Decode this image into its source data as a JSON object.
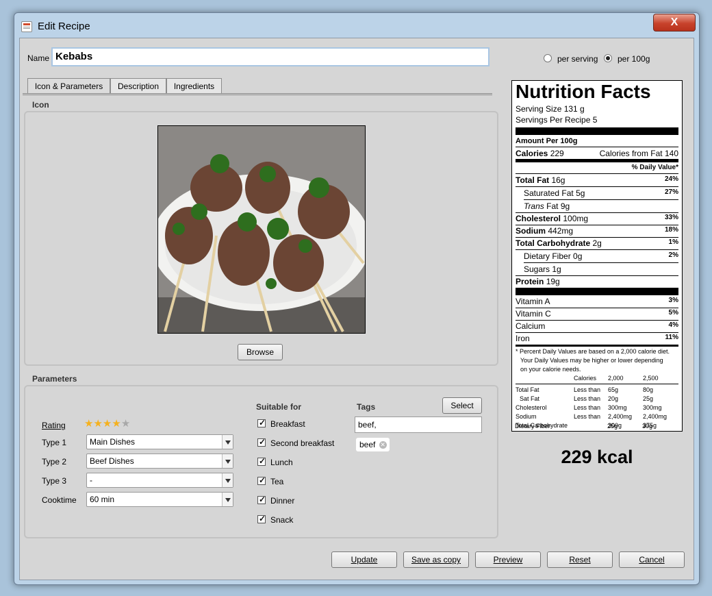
{
  "window": {
    "title": "Edit Recipe",
    "close_label": "X"
  },
  "name": {
    "label": "Name",
    "value": "Kebabs"
  },
  "units": {
    "per_serving": "per serving",
    "per_100g": "per 100g",
    "selected": "per_100g"
  },
  "tabs": [
    "Icon & Parameters",
    "Description",
    "Ingredients"
  ],
  "icon_section": {
    "title": "Icon",
    "image": "kebab-photo",
    "browse_label": "Browse"
  },
  "parameters": {
    "title": "Parameters",
    "rating_label": "Rating",
    "rating": 4,
    "rating_max": 5,
    "type1_label": "Type 1",
    "type1_value": "Main Dishes",
    "type2_label": "Type 2",
    "type2_value": "Beef Dishes",
    "type3_label": "Type 3",
    "type3_value": "-",
    "cooktime_label": "Cooktime",
    "cooktime_value": "60 min"
  },
  "suitable": {
    "title": "Suitable for",
    "items": [
      {
        "label": "Breakfast",
        "checked": true
      },
      {
        "label": "Second breakfast",
        "checked": true
      },
      {
        "label": "Lunch",
        "checked": true
      },
      {
        "label": "Tea",
        "checked": true
      },
      {
        "label": "Dinner",
        "checked": true
      },
      {
        "label": "Snack",
        "checked": true
      }
    ]
  },
  "tags": {
    "title": "Tags",
    "select_label": "Select",
    "input_value": "beef,",
    "chips": [
      "beef"
    ]
  },
  "nutrition": {
    "heading": "Nutrition Facts",
    "serving_size": "Serving Size 131 g",
    "servings_per_recipe": "Servings Per Recipe 5",
    "amount_per": "Amount Per 100g",
    "calories_label": "Calories",
    "calories": "229",
    "calories_fat": "Calories from Fat 140",
    "dv_header": "% Daily Value*",
    "rows": {
      "total_fat": {
        "label": "Total Fat",
        "amount": "16g",
        "dv": "24%"
      },
      "sat_fat": {
        "label": "Saturated Fat",
        "amount": "5g",
        "dv": "27%"
      },
      "trans_fat": {
        "label": "Trans",
        "label2": "Fat",
        "amount": "9g"
      },
      "cholesterol": {
        "label": "Cholesterol",
        "amount": "100mg",
        "dv": "33%"
      },
      "sodium": {
        "label": "Sodium",
        "amount": "442mg",
        "dv": "18%"
      },
      "carb": {
        "label": "Total Carbohydrate",
        "amount": "2g",
        "dv": "1%"
      },
      "fiber": {
        "label": "Dietary Fiber",
        "amount": "0g",
        "dv": "2%"
      },
      "sugars": {
        "label": "Sugars",
        "amount": "1g"
      },
      "protein": {
        "label": "Protein",
        "amount": "19g"
      }
    },
    "vitamins": [
      {
        "label": "Vitamin A",
        "dv": "3%"
      },
      {
        "label": "Vitamin C",
        "dv": "5%"
      },
      {
        "label": "Calcium",
        "dv": "4%"
      },
      {
        "label": "Iron",
        "dv": "11%"
      }
    ],
    "footnote1": "* Percent Daily Values are based on a 2,000 calorie diet.",
    "footnote2": "Your Daily Values may be higher or lower depending",
    "footnote3": "on your calorie needs.",
    "table_header": [
      "Calories",
      "2,000",
      "2,500"
    ],
    "table_rows": [
      [
        "Total Fat",
        "Less than",
        "65g",
        "80g"
      ],
      [
        "Sat Fat",
        "Less than",
        "20g",
        "25g"
      ],
      [
        "Cholesterol",
        "Less than",
        "300mg",
        "300mg"
      ],
      [
        "Sodium",
        "Less than",
        "2,400mg",
        "2,400mg"
      ],
      [
        "Total Carbohydrate",
        "",
        "300g",
        "375g"
      ],
      [
        "Dietary Fiber",
        "",
        "25g",
        "30g"
      ]
    ]
  },
  "kcal_total": "229 kcal",
  "buttons": {
    "update": "Update",
    "save_copy": "Save as copy",
    "preview": "Preview",
    "reset": "Reset",
    "cancel": "Cancel"
  }
}
